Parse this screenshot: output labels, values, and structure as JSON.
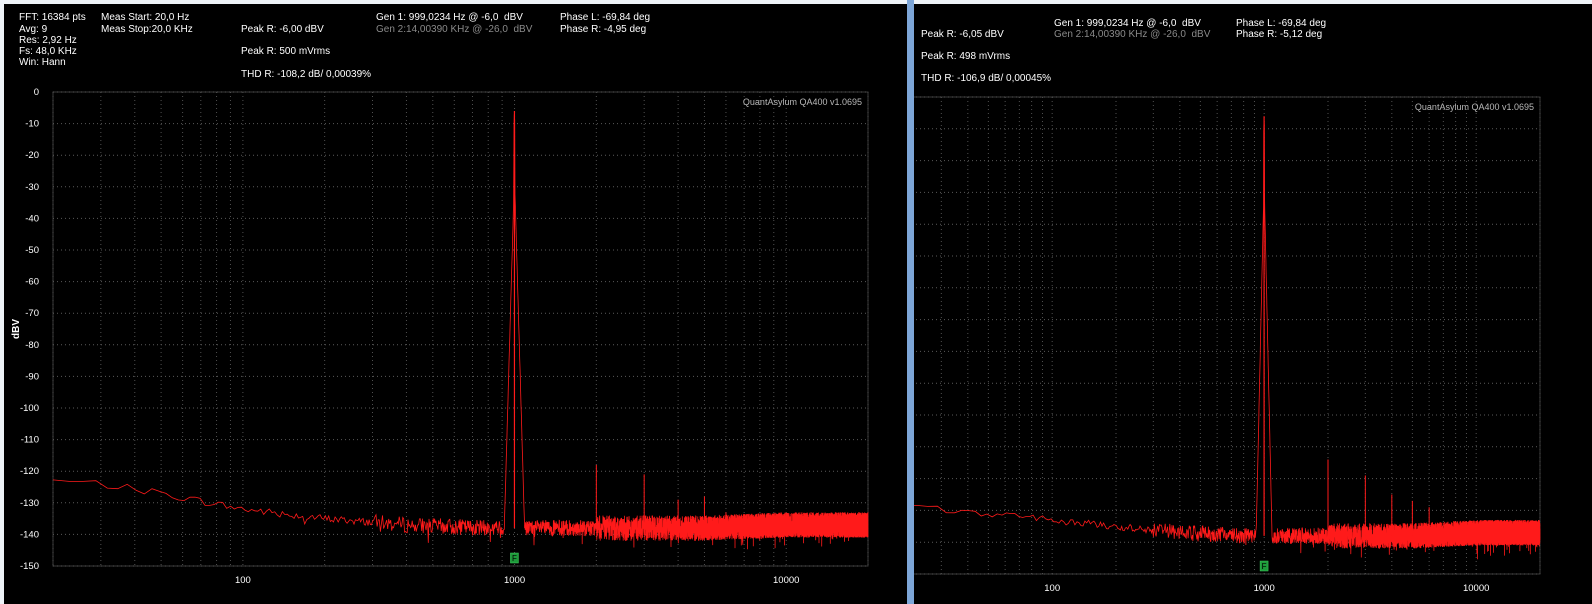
{
  "left": {
    "info": {
      "fft": "FFT: 16384 pts",
      "avg": "Avg: 9",
      "res": "Res: 2,92 Hz",
      "fs": "Fs: 48,0 KHz",
      "win": "Win: Hann",
      "meas_start": "Meas Start: 20,0 Hz",
      "meas_stop": "Meas Stop:20,0 KHz",
      "peak_r_db": "Peak R: -6,00 dBV",
      "peak_r_mv": "Peak R: 500 mVrms",
      "thd_r": "THD R: -108,2 dB/ 0,00039%",
      "gen1": "Gen 1: 999,0234 Hz @ -6,0  dBV",
      "gen2": "Gen 2:14,00390 KHz @ -26,0  dBV",
      "phase_l": "Phase L: -69,84 deg",
      "phase_r": "Phase R: -4,95 deg"
    },
    "watermark": "QuantAsylum QA400 v1.0695",
    "ylabel": "dBV",
    "marker": "F"
  },
  "right": {
    "info": {
      "peak_r_db": "Peak R: -6,05 dBV",
      "peak_r_mv": "Peak R: 498 mVrms",
      "thd_r": "THD R: -106,9 dB/ 0,00045%",
      "gen1": "Gen 1: 999,0234 Hz @ -6,0  dBV",
      "gen2": "Gen 2:14,00390 KHz @ -26,0  dBV",
      "phase_l": "Phase L: -69,84 deg",
      "phase_r": "Phase R: -5,12 deg"
    },
    "watermark": "QuantAsylum QA400 v1.0695",
    "marker": "F"
  },
  "chart_data": [
    {
      "type": "line",
      "title": "",
      "xlabel": "",
      "ylabel": "dBV",
      "xscale": "log",
      "xlim": [
        20,
        20000
      ],
      "ylim": [
        -150,
        0
      ],
      "x_ticks": [
        "100",
        "1000",
        "10000"
      ],
      "y_ticks": [
        "0",
        "-10",
        "-20",
        "-30",
        "-40",
        "-50",
        "-60",
        "-70",
        "-80",
        "-90",
        "-100",
        "-110",
        "-120",
        "-130",
        "-140",
        "-150"
      ],
      "grid": true,
      "series_color": "#ff1a1a",
      "noise_floor": [
        [
          20,
          -123
        ],
        [
          30,
          -124
        ],
        [
          50,
          -127
        ],
        [
          100,
          -132
        ],
        [
          200,
          -135
        ],
        [
          400,
          -137
        ],
        [
          800,
          -138
        ],
        [
          2000,
          -138
        ],
        [
          5000,
          -138
        ],
        [
          10000,
          -137
        ],
        [
          20000,
          -137
        ]
      ],
      "peaks": [
        {
          "x": 999.0234,
          "y": -6.0
        },
        {
          "x": 2000,
          "y": -118
        },
        {
          "x": 3000,
          "y": -121
        },
        {
          "x": 4000,
          "y": -129
        },
        {
          "x": 5000,
          "y": -128
        },
        {
          "x": 6000,
          "y": -133
        }
      ]
    },
    {
      "type": "line",
      "title": "",
      "xlabel": "",
      "ylabel": "",
      "xscale": "log",
      "xlim": [
        20,
        20000
      ],
      "ylim": [
        -150,
        0
      ],
      "x_ticks": [
        "100",
        "1000",
        "10000"
      ],
      "grid": true,
      "series_color": "#ff1a1a",
      "noise_floor": [
        [
          20,
          -129
        ],
        [
          50,
          -131
        ],
        [
          100,
          -133
        ],
        [
          200,
          -135
        ],
        [
          400,
          -137
        ],
        [
          800,
          -138
        ],
        [
          2000,
          -138
        ],
        [
          5000,
          -138
        ],
        [
          10000,
          -137
        ],
        [
          20000,
          -137
        ]
      ],
      "peaks": [
        {
          "x": 999.0234,
          "y": -6.05
        },
        {
          "x": 2000,
          "y": -114
        },
        {
          "x": 3000,
          "y": -119
        },
        {
          "x": 4000,
          "y": -125
        },
        {
          "x": 5000,
          "y": -127
        },
        {
          "x": 6000,
          "y": -129
        }
      ]
    }
  ]
}
